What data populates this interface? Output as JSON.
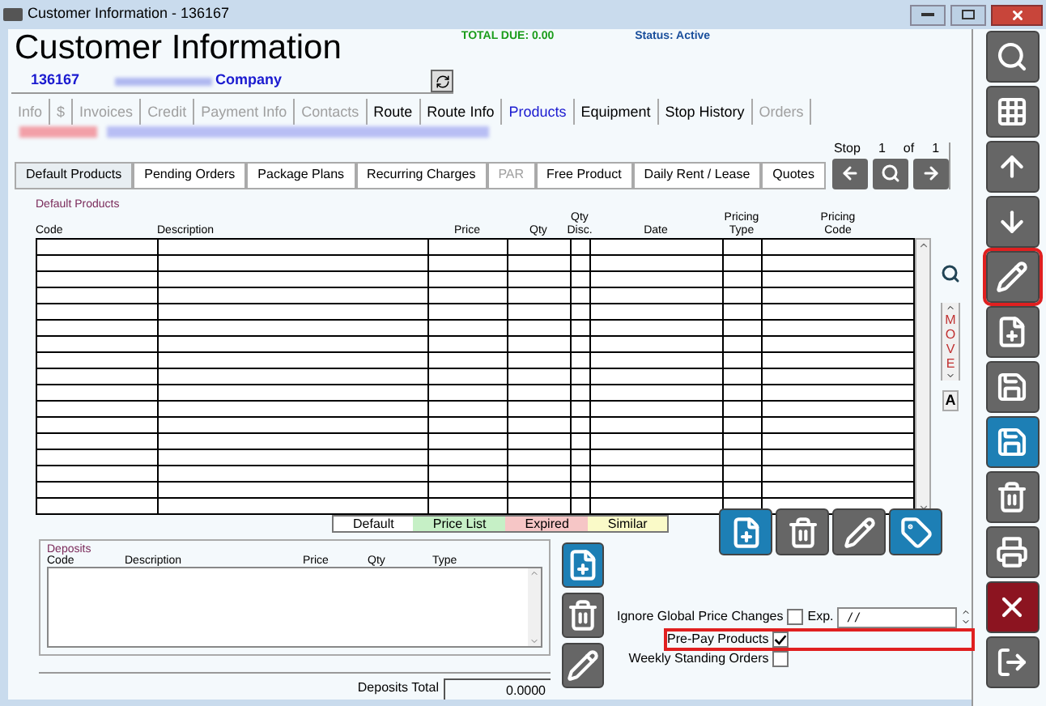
{
  "window": {
    "title": "Customer Information - 136167"
  },
  "header": {
    "title": "Customer Information",
    "total_due_label": "TOTAL DUE:",
    "total_due": "0.00",
    "status_label": "Status:",
    "status": "Active"
  },
  "account": {
    "number": "136167",
    "company": "Company"
  },
  "tabs": [
    {
      "label": "Info",
      "disabled": true,
      "selected": false
    },
    {
      "label": "$",
      "disabled": true,
      "selected": false
    },
    {
      "label": "Invoices",
      "disabled": true,
      "selected": false
    },
    {
      "label": "Credit",
      "disabled": true,
      "selected": false
    },
    {
      "label": "Payment Info",
      "disabled": true,
      "selected": false
    },
    {
      "label": "Contacts",
      "disabled": true,
      "selected": false
    },
    {
      "label": "Route",
      "disabled": false,
      "selected": false
    },
    {
      "label": "Route Info",
      "disabled": false,
      "selected": false
    },
    {
      "label": "Products",
      "disabled": false,
      "selected": true
    },
    {
      "label": "Equipment",
      "disabled": false,
      "selected": false
    },
    {
      "label": "Stop History",
      "disabled": false,
      "selected": false
    },
    {
      "label": "Orders",
      "disabled": true,
      "selected": false
    }
  ],
  "subtabs": [
    {
      "label": "Default Products",
      "disabled": false,
      "selected": true
    },
    {
      "label": "Pending Orders",
      "disabled": false,
      "selected": false
    },
    {
      "label": "Package Plans",
      "disabled": false,
      "selected": false
    },
    {
      "label": "Recurring Charges",
      "disabled": false,
      "selected": false
    },
    {
      "label": "PAR",
      "disabled": true,
      "selected": false
    },
    {
      "label": "Free Product",
      "disabled": false,
      "selected": false
    },
    {
      "label": "Daily Rent / Lease",
      "disabled": false,
      "selected": false
    },
    {
      "label": "Quotes",
      "disabled": false,
      "selected": false
    }
  ],
  "stop": {
    "label": "Stop",
    "current": "1",
    "of": "of",
    "total": "1"
  },
  "products_table": {
    "title": "Default Products",
    "columns": [
      [
        "Code"
      ],
      [
        "Description"
      ],
      [
        "Price"
      ],
      [
        "Qty"
      ],
      [
        "Qty",
        "Disc."
      ],
      [
        "Date"
      ],
      [
        "Pricing",
        "Type"
      ],
      [
        "Pricing",
        "Code"
      ]
    ]
  },
  "move": {
    "label": "MOVE",
    "sort_label": "A"
  },
  "legend": [
    {
      "label": "Default",
      "color": "#ffffff"
    },
    {
      "label": "Price List",
      "color": "#c6f0c6"
    },
    {
      "label": "Expired",
      "color": "#f6c6c6"
    },
    {
      "label": "Similar",
      "color": "#fafac8"
    }
  ],
  "product_actions": [
    {
      "kind": "add"
    },
    {
      "kind": "delete"
    },
    {
      "kind": "edit"
    },
    {
      "kind": "price"
    }
  ],
  "deposits": {
    "title": "Deposits",
    "columns": [
      "Code",
      "Description",
      "Price",
      "Qty",
      "Type"
    ],
    "total_label": "Deposits Total",
    "total": "0.0000"
  },
  "deposit_actions": [
    {
      "kind": "add"
    },
    {
      "kind": "delete"
    },
    {
      "kind": "edit"
    }
  ],
  "options": [
    {
      "label": "Ignore Global Price Changes",
      "checked": false,
      "highlighted": false
    },
    {
      "label": "Pre-Pay Products",
      "checked": true,
      "highlighted": true
    },
    {
      "label": "Weekly Standing Orders",
      "checked": false,
      "highlighted": false
    }
  ],
  "expiry": {
    "label": "Exp.",
    "value": "/ /"
  },
  "sidebar": [
    {
      "kind": "search",
      "highlighted": false
    },
    {
      "kind": "grid",
      "highlighted": false
    },
    {
      "kind": "up",
      "highlighted": false
    },
    {
      "kind": "down",
      "highlighted": false
    },
    {
      "kind": "edit",
      "highlighted": true
    },
    {
      "kind": "new",
      "highlighted": false
    },
    {
      "kind": "save-new",
      "highlighted": false
    },
    {
      "kind": "save",
      "highlighted": false
    },
    {
      "kind": "delete",
      "highlighted": false
    },
    {
      "kind": "print",
      "highlighted": false
    },
    {
      "kind": "cancel",
      "highlighted": false
    },
    {
      "kind": "exit",
      "highlighted": false
    }
  ]
}
